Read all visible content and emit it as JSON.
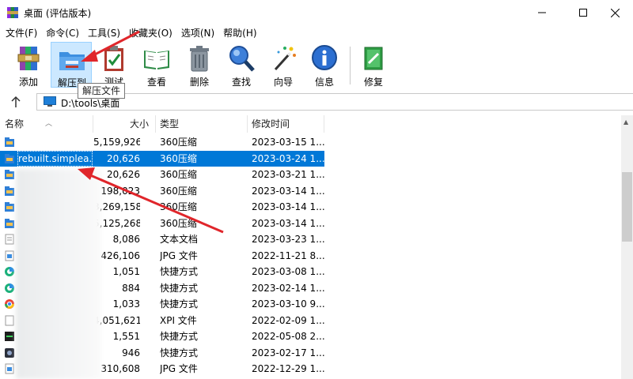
{
  "window": {
    "title": "桌面 (评估版本)"
  },
  "menu": [
    "文件(F)",
    "命令(C)",
    "工具(S)",
    "收藏夹(O)",
    "选项(N)",
    "帮助(H)"
  ],
  "toolbar": {
    "add": "添加",
    "extract": "解压到",
    "test": "测试",
    "view": "查看",
    "delete": "删除",
    "find": "查找",
    "wizard": "向导",
    "info": "信息",
    "repair": "修复"
  },
  "tooltip": "解压文件",
  "address": {
    "path": "D:\\tools\\桌面"
  },
  "columns": {
    "name": "名称",
    "size": "大小",
    "type": "类型",
    "modified": "修改时间"
  },
  "files": [
    {
      "name": "",
      "size": "5,159,926",
      "type": "360压缩",
      "date": "2023-03-15 1...",
      "icon": "archive-icon"
    },
    {
      "name": "rebuilt.simplea...",
      "size": "20,626",
      "type": "360压缩",
      "date": "2023-03-24 1...",
      "icon": "archive-icon",
      "selected": true
    },
    {
      "name": "",
      "size": "20,626",
      "type": "360压缩",
      "date": "2023-03-21 1...",
      "icon": "archive-icon"
    },
    {
      "name": "",
      "size": "198,023",
      "type": "360压缩",
      "date": "2023-03-14 1...",
      "icon": "archive-icon"
    },
    {
      "name": "",
      "size": "3,269,158",
      "type": "360压缩",
      "date": "2023-03-14 1...",
      "icon": "archive-icon"
    },
    {
      "name": "",
      "size": "5,125,268",
      "type": "360压缩",
      "date": "2023-03-14 1...",
      "icon": "archive-icon"
    },
    {
      "name": "",
      "size": "8,086",
      "type": "文本文档",
      "date": "2023-03-23 1...",
      "icon": "text-file-icon"
    },
    {
      "name": "",
      "size": "426,106",
      "type": "JPG 文件",
      "date": "2022-11-21 8...",
      "icon": "image-file-icon"
    },
    {
      "name": "",
      "size": "1,051",
      "type": "快捷方式",
      "date": "2023-03-08 1...",
      "icon": "edge-shortcut-icon"
    },
    {
      "name": "",
      "size": "884",
      "type": "快捷方式",
      "date": "2023-02-14 1...",
      "icon": "edge-shortcut-icon"
    },
    {
      "name": "",
      "size": "1,033",
      "type": "快捷方式",
      "date": "2023-03-10 9...",
      "icon": "chrome-shortcut-icon"
    },
    {
      "name": "",
      "size": "4,051,621",
      "type": "XPI 文件",
      "date": "2022-02-09 1...",
      "icon": "blank-file-icon"
    },
    {
      "name": "",
      "size": "1,551",
      "type": "快捷方式",
      "date": "2022-05-08 2...",
      "icon": "app-shortcut-icon"
    },
    {
      "name": "",
      "size": "946",
      "type": "快捷方式",
      "date": "2023-02-17 1...",
      "icon": "dark-shortcut-icon"
    },
    {
      "name": "",
      "size": "310,608",
      "type": "JPG 文件",
      "date": "2022-12-29 1...",
      "icon": "image-file-icon"
    }
  ],
  "colors": {
    "selection": "#0078d7",
    "annotation_arrow": "#e0262b"
  }
}
